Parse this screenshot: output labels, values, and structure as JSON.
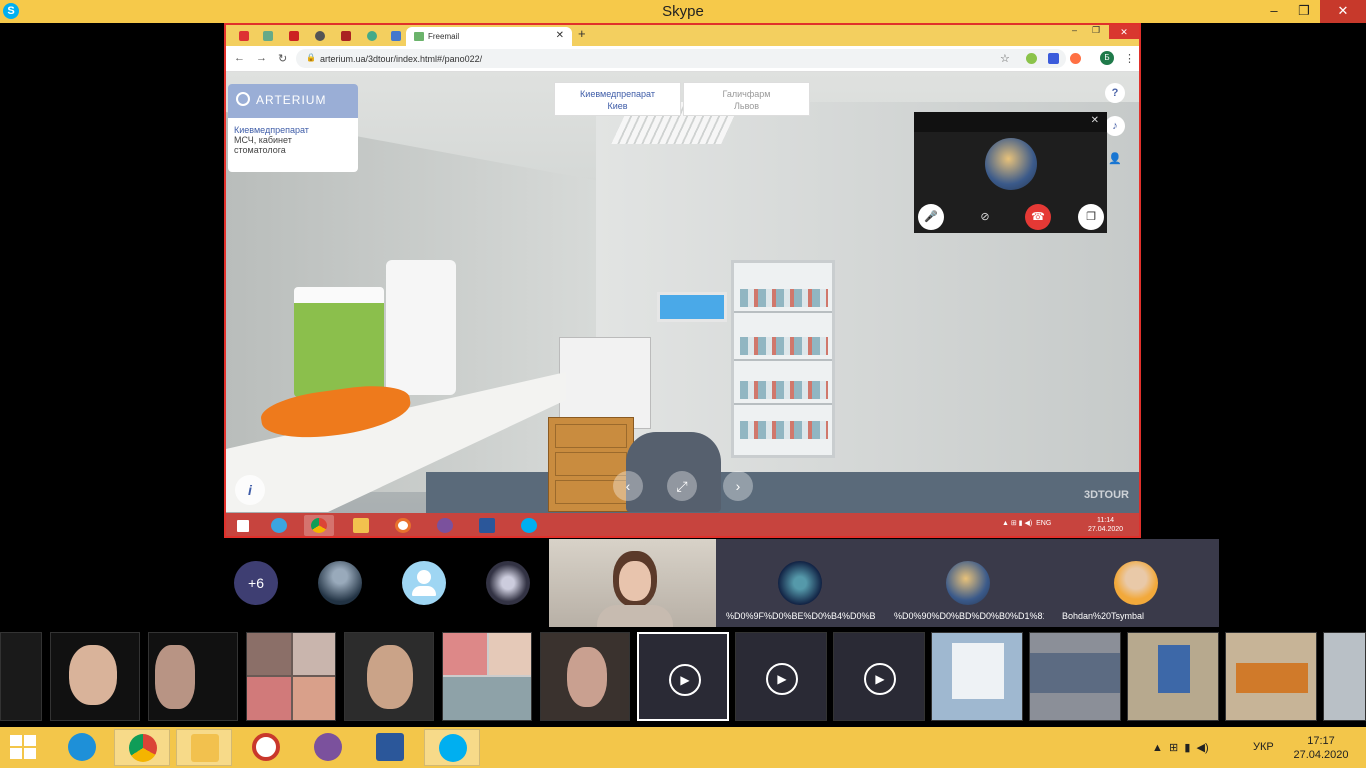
{
  "window": {
    "title": "Skype",
    "logo": "skype-icon",
    "min": "–",
    "max": "❐",
    "close": "✕"
  },
  "browser": {
    "active_tab_title": "Freemail",
    "new_tab": "+",
    "url": "arterium.ua/3dtour/index.html#/pano022/",
    "profile_initial": "Б",
    "menu": "⋮"
  },
  "tour": {
    "brand": "ARTERIUM",
    "location_title": "Киевмедпрепарат",
    "location_desc_1": "МСЧ, кабинет",
    "location_desc_2": "стоматолога",
    "locations": [
      {
        "line1": "Киевмедпрепарат",
        "line2": "Киев"
      },
      {
        "line1": "Галичфарм",
        "line2": "Львов"
      }
    ],
    "side_icons": [
      "?",
      "♪",
      "👤"
    ],
    "info": "i",
    "prev": "‹",
    "fullscreen": "⤢",
    "next": "›",
    "logo": "3DTOUR"
  },
  "call_popup": {
    "close": "✕",
    "buttons": [
      "mic-icon",
      "video-off-icon",
      "hang-up-icon",
      "switch-window-icon"
    ]
  },
  "inner_taskbar": {
    "lang": "ENG",
    "time": "11:14",
    "date": "27.04.2020"
  },
  "participants": {
    "more_count": "+6",
    "tiles": [
      {
        "label": ""
      },
      {
        "label": "%D0%9F%D0%BE%D0%B4%D0%B..."
      },
      {
        "label": "%D0%90%D0%BD%D0%B0%D1%81..."
      },
      {
        "label": "Bohdan%20Tsymbal"
      }
    ]
  },
  "taskbar": {
    "lang": "УКР",
    "time": "17:17",
    "date": "27.04.2020"
  }
}
